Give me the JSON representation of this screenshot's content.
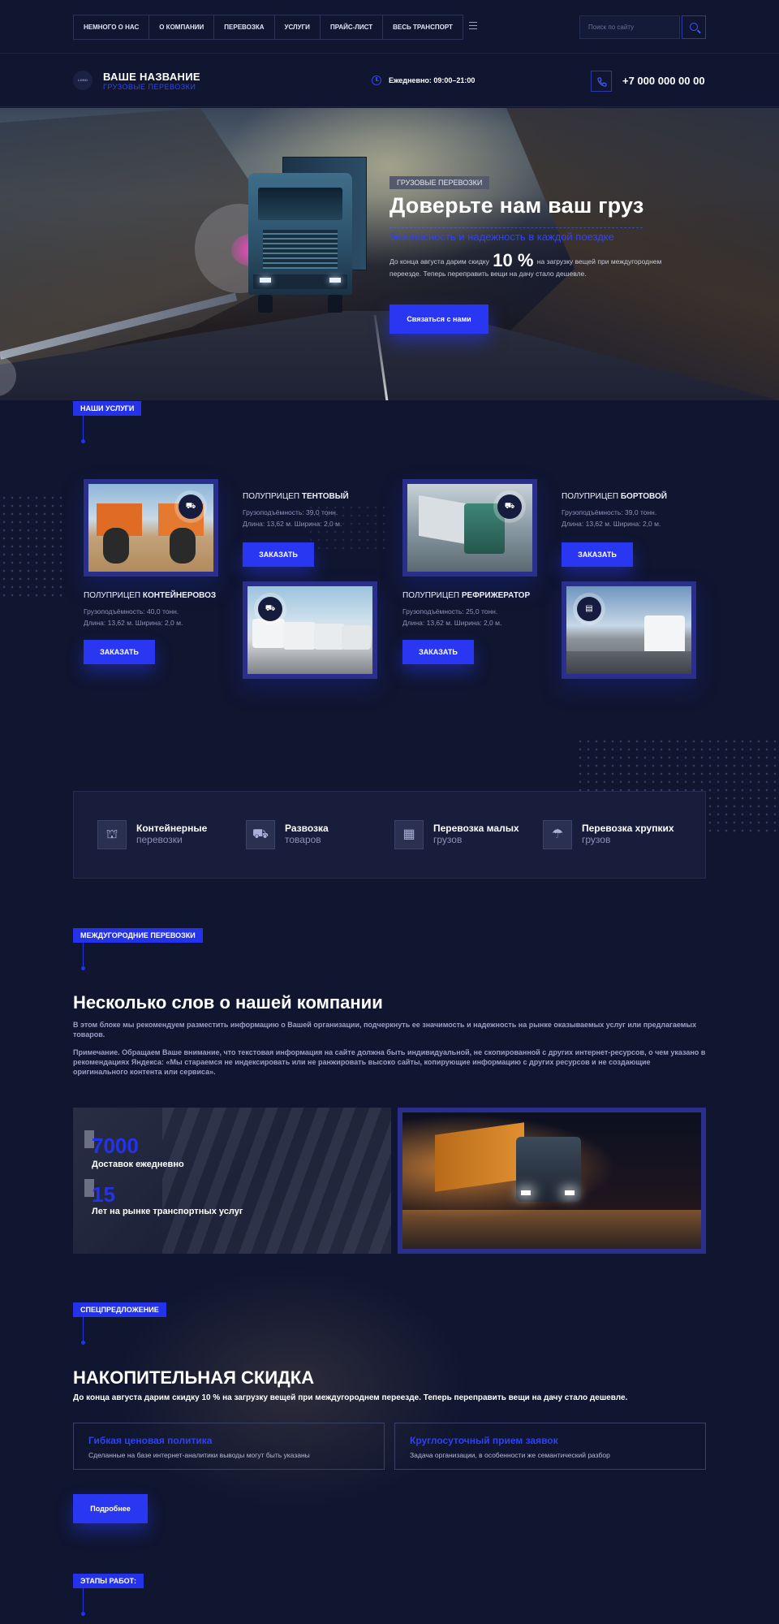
{
  "nav": {
    "items": [
      "НЕМНОГО О НАС",
      "О КОМПАНИИ",
      "ПЕРЕВОЗКА",
      "УСЛУГИ",
      "ПРАЙС-ЛИСТ",
      "ВЕСЬ ТРАНСПОРТ"
    ],
    "search_placeholder": "Поиск по сайту"
  },
  "header": {
    "logo_text": "LOGO",
    "site_title": "ВАШЕ НАЗВАНИЕ",
    "site_subtitle": "ГРУЗОВЫЕ ПЕРЕВОЗКИ",
    "hours": "Ежедневно: 09:00–21:00",
    "phone": "+7 000 000 00 00"
  },
  "hero": {
    "tag": "ГРУЗОВЫЕ ПЕРЕВОЗКИ",
    "title": "Доверьте нам ваш груз",
    "subtitle": "безопасность и надежность в каждой поездке",
    "desc_before": "До конца августа дарим скидку",
    "discount": "10 %",
    "desc_after": "на загрузку вещей при междугороднем переезде. Теперь переправить вещи на дачу стало дешевле.",
    "button": "Связаться с нами"
  },
  "services": {
    "tag": "НАШИ УСЛУГИ",
    "order_label": "ЗАКАЗАТЬ",
    "items": [
      {
        "prefix": "ПОЛУПРИЦЕП",
        "name": "ТЕНТОВЫЙ",
        "spec1": "Грузоподъёмность: 39,0 тонн.",
        "spec2": "Длина: 13,62 м. Ширина: 2,0 м."
      },
      {
        "prefix": "ПОЛУПРИЦЕП",
        "name": "БОРТОВОЙ",
        "spec1": "Грузоподъёмность: 39,0 тонн.",
        "spec2": "Длина: 13,62 м. Ширина: 2,0 м."
      },
      {
        "prefix": "ПОЛУПРИЦЕП",
        "name": "КОНТЕЙНЕРОВОЗ",
        "spec1": "Грузоподъёмность: 40,0 тонн.",
        "spec2": "Длина: 13,62 м. Ширина: 2,0 м."
      },
      {
        "prefix": "ПОЛУПРИЦЕП",
        "name": "РЕФРИЖЕРАТОР",
        "spec1": "Грузоподъёмность: 25,0 тонн.",
        "spec2": "Длина: 13,62 м. Ширина: 2,0 м."
      }
    ]
  },
  "features": [
    {
      "title": "Контейнерные",
      "sub": "перевозки",
      "icon": "container-icon"
    },
    {
      "title": "Развозка",
      "sub": "товаров",
      "icon": "delivery-icon"
    },
    {
      "title": "Перевозка малых",
      "sub": "грузов",
      "icon": "boxes-icon"
    },
    {
      "title": "Перевозка хрупких",
      "sub": "грузов",
      "icon": "fragile-icon"
    }
  ],
  "about": {
    "tag": "МЕЖДУГОРОДНИЕ ПЕРЕВОЗКИ",
    "title": "Несколько слов о нашей компании",
    "p1": "В этом блоке мы рекомендуем разместить информацию о Вашей организации, подчеркнуть ее значимость и надежность на рынке оказываемых услуг или предлагаемых товаров.",
    "p2": "Примечание. Обращаем Ваше внимание, что текстовая информация на сайте должна быть индивидуальной, не скопированной с других интернет-ресурсов, о чем указано в рекомендациях Яндекса: «Мы стараемся не индексировать или не ранжировать высоко сайты, копирующие информацию с других ресурсов и не создающие оригинального контента или сервиса»."
  },
  "stats": [
    {
      "value": "7000",
      "label": "Доставок ежедневно"
    },
    {
      "value": "15",
      "label": "Лет на рынке транспортных услуг"
    }
  ],
  "special": {
    "tag": "СПЕЦПРЕДЛОЖЕНИЕ",
    "title": "НАКОПИТЕЛЬНАЯ СКИДКА",
    "desc": "До конца августа дарим скидку 10 % на загрузку вещей при междугороднем переезде. Теперь переправить вещи на дачу стало дешевле.",
    "cards": [
      {
        "title": "Гибкая ценовая политика",
        "text": "Сделанные на базе интернет-аналитики выводы могут быть указаны"
      },
      {
        "title": "Круглосуточный прием заявок",
        "text": "Задача организации, в особенности же семантический разбор"
      }
    ],
    "button": "Подробнее"
  },
  "stages": {
    "tag": "ЭТАПЫ РАБОТ:"
  },
  "colors": {
    "background": "#101630",
    "accent": "#2a37f2",
    "accent_text": "#2f43ff"
  }
}
